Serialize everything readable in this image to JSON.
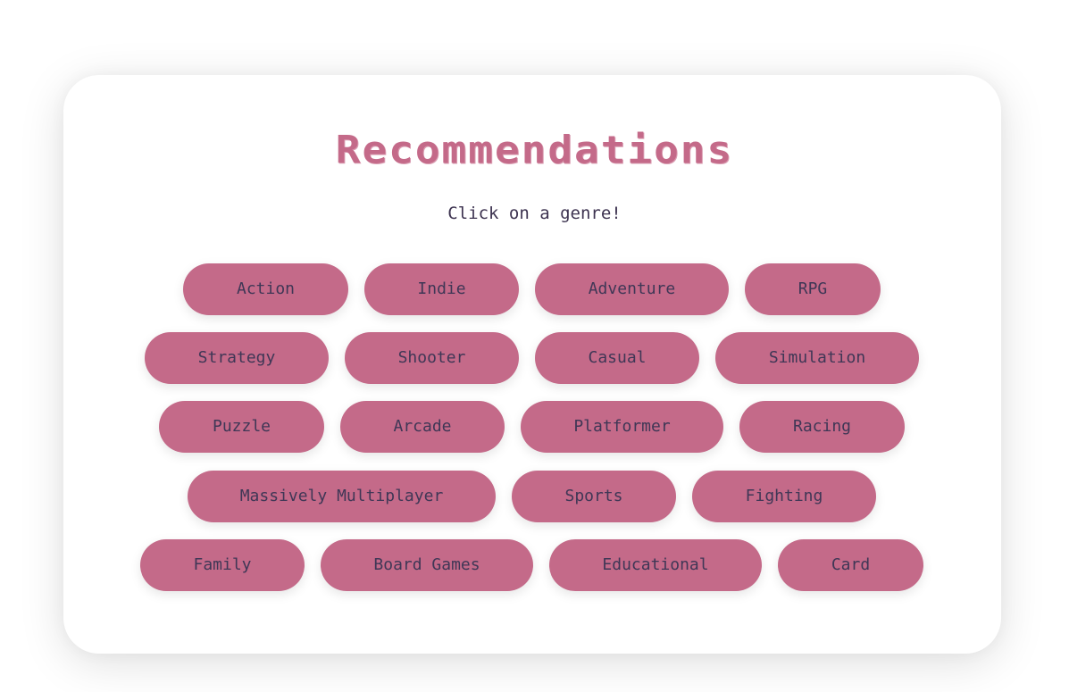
{
  "header": {
    "title": "Recommendations",
    "subtitle": "Click on a genre!"
  },
  "genres": [
    "Action",
    "Indie",
    "Adventure",
    "RPG",
    "Strategy",
    "Shooter",
    "Casual",
    "Simulation",
    "Puzzle",
    "Arcade",
    "Platformer",
    "Racing",
    "Massively Multiplayer",
    "Sports",
    "Fighting",
    "Family",
    "Board Games",
    "Educational",
    "Card"
  ],
  "colors": {
    "accent": "#c46a89",
    "button_text": "#3f3756",
    "subtitle_text": "#3d3350",
    "card_background": "#ffffff"
  }
}
